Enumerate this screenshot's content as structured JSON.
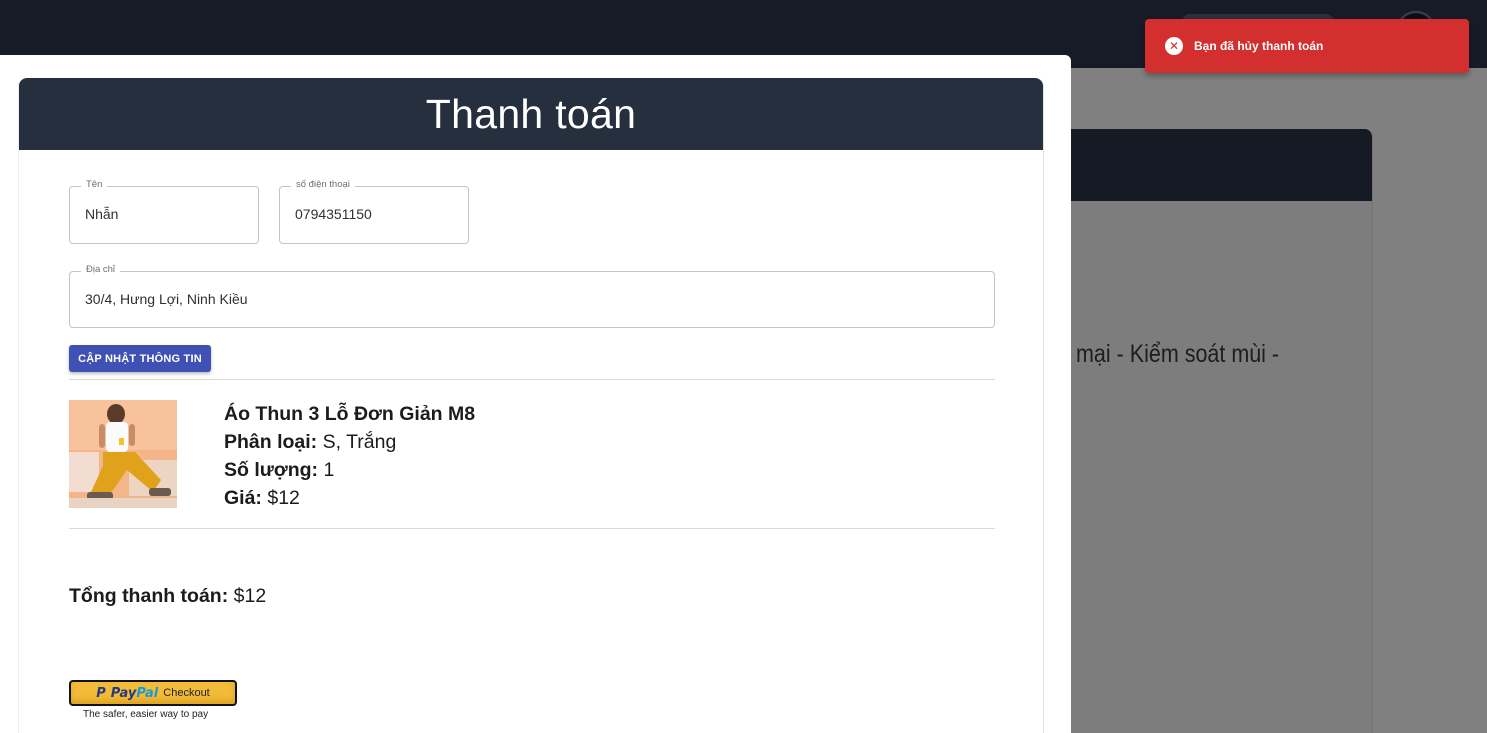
{
  "background": {
    "partial_text": "mại - Kiểm soát mùi -"
  },
  "checkout": {
    "title": "Thanh toán",
    "form": {
      "name": {
        "label": "Tên",
        "value": "Nhẫn"
      },
      "phone": {
        "label": "số điện thoại",
        "value": "0794351150"
      },
      "address": {
        "label": "Địa chỉ",
        "value": "30/4, Hưng Lợi, Ninh Kiều"
      },
      "update_button": "CẬP NHẬT THÔNG TIN"
    },
    "item": {
      "name": "Áo Thun 3 Lỗ Đơn Giản M8",
      "variant_label": "Phân loại:",
      "variant_value": "S, Trắng",
      "quantity_label": "Số lượng:",
      "quantity_value": "1",
      "price_label": "Giá:",
      "price_value": "$12"
    },
    "total_label": "Tổng thanh toán:",
    "total_value": "$12",
    "paypal": {
      "p": "P",
      "pay": "Pay",
      "pal": "Pal",
      "checkout": "Checkout",
      "tagline": "The safer, easier way to pay"
    }
  },
  "toast": {
    "icon": "close-circle-icon",
    "message": "Bạn đã hủy thanh toán",
    "color": "#d32f2f"
  },
  "colors": {
    "header": "#262f3e",
    "primary_button": "#3f51b5",
    "paypal_yellow": "#f2bb39"
  }
}
